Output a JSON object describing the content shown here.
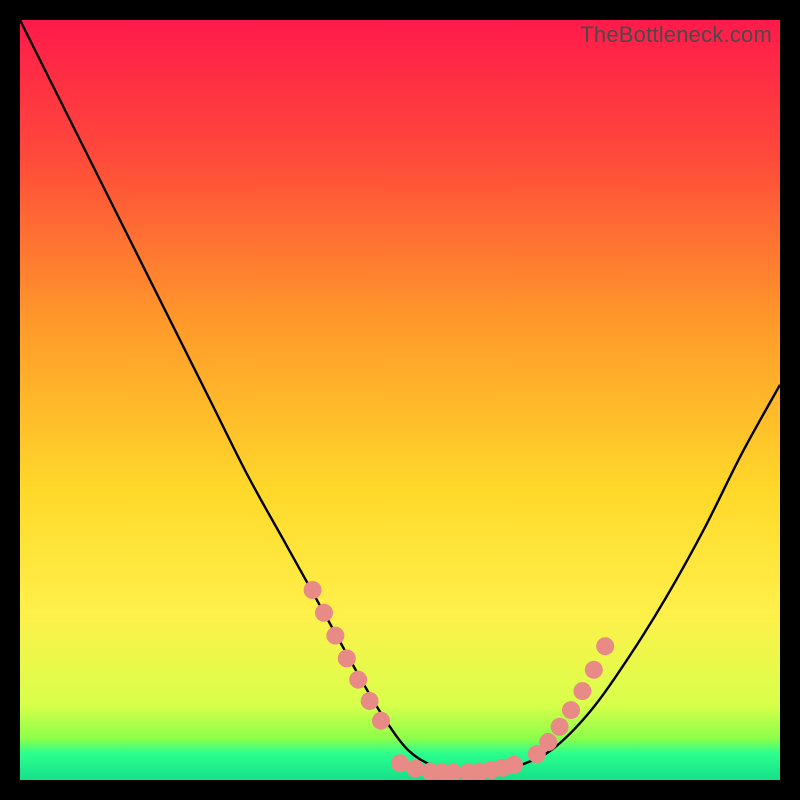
{
  "watermark": "TheBottleneck.com",
  "chart_data": {
    "type": "line",
    "title": "",
    "xlabel": "",
    "ylabel": "",
    "xlim": [
      0,
      100
    ],
    "ylim": [
      0,
      100
    ],
    "gradient_stops": [
      {
        "offset": 0.0,
        "color": "#ff1a4b"
      },
      {
        "offset": 0.18,
        "color": "#ff4a3a"
      },
      {
        "offset": 0.4,
        "color": "#ff9a2a"
      },
      {
        "offset": 0.62,
        "color": "#ffd92a"
      },
      {
        "offset": 0.78,
        "color": "#fff04a"
      },
      {
        "offset": 0.9,
        "color": "#d9ff4a"
      },
      {
        "offset": 0.945,
        "color": "#8dff4a"
      },
      {
        "offset": 0.965,
        "color": "#2bff8d"
      },
      {
        "offset": 1.0,
        "color": "#16e08a"
      }
    ],
    "curve": {
      "x": [
        0,
        5,
        10,
        15,
        20,
        25,
        30,
        35,
        40,
        45,
        48,
        51,
        54,
        57,
        60,
        63,
        66,
        70,
        75,
        80,
        85,
        90,
        95,
        100
      ],
      "y": [
        100,
        90,
        80,
        70,
        60,
        50,
        40,
        31,
        22,
        13,
        8,
        4,
        2,
        1,
        1,
        1,
        2,
        4,
        9,
        16,
        24,
        33,
        43,
        52
      ]
    },
    "marker_segments": [
      {
        "x": [
          38.5,
          40,
          41.5,
          43,
          44.5,
          46,
          47.5
        ],
        "y": [
          25,
          22,
          19,
          16,
          13.2,
          10.4,
          7.8
        ]
      },
      {
        "x": [
          50,
          52,
          54,
          55.5,
          57,
          59,
          60.5,
          62,
          63.5,
          65
        ],
        "y": [
          2.2,
          1.5,
          1.1,
          1.0,
          1.0,
          1.0,
          1.1,
          1.3,
          1.6,
          2.0
        ]
      },
      {
        "x": [
          68,
          69.5,
          71,
          72.5,
          74,
          75.5,
          77
        ],
        "y": [
          3.4,
          5.0,
          7.0,
          9.2,
          11.7,
          14.5,
          17.6
        ]
      }
    ],
    "marker_style": {
      "color": "#e88a86",
      "radius": 9
    }
  }
}
